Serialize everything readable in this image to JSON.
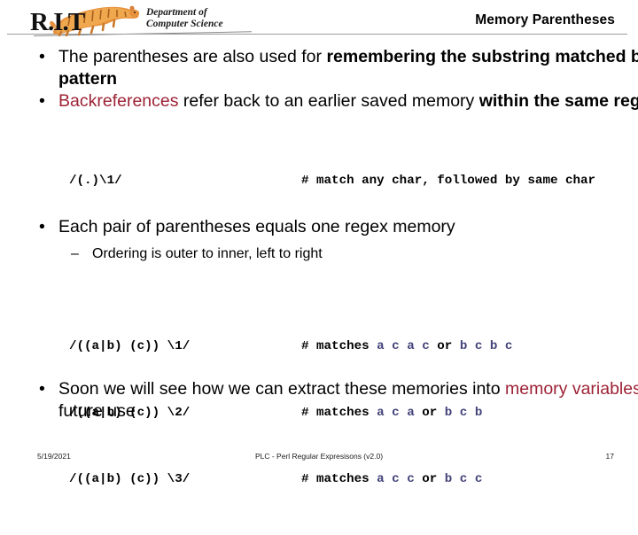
{
  "header": {
    "logo": {
      "rit_text": "R.I.T",
      "dept_line1": "Department of",
      "dept_line2": "Computer Science",
      "tiger_icon": "tiger-mascot-icon"
    },
    "title": "Memory Parentheses"
  },
  "slide": {
    "bullet1": {
      "marker": "•",
      "plain": "The parentheses are also used for ",
      "bold": "remembering the substring matched by the pattern"
    },
    "bullet2": {
      "marker": "•",
      "red": "Backreferences",
      "plain": " refer back to an earlier saved memory ",
      "bold": "within the same regex"
    },
    "code_block_1": {
      "pattern": "/(.)\\1/",
      "comment": "# match any char, followed by same char"
    },
    "bullet3": {
      "marker": "•",
      "text": "Each pair of parentheses equals one regex memory"
    },
    "subbullet1": {
      "marker": "–",
      "text": "Ordering is outer to inner, left to right"
    },
    "code_block_2": {
      "rows": [
        {
          "pattern": "/((a|b) (c)) \\1/",
          "comment_prefix": "# matches ",
          "match_a": "a c a c",
          "separator": " or ",
          "match_b": "b c b c"
        },
        {
          "pattern": "/((a|b) (c)) \\2/",
          "comment_prefix": "# matches ",
          "match_a": "a c a",
          "separator": " or ",
          "match_b": "b c b"
        },
        {
          "pattern": "/((a|b) (c)) \\3/",
          "comment_prefix": "# matches ",
          "match_a": "a c c",
          "separator": " or ",
          "match_b": "b c c"
        }
      ]
    },
    "bullet4": {
      "marker": "•",
      "plain1": "Soon we will see how we can extract these memories into ",
      "red": "memory variables",
      "plain2": " for future use"
    }
  },
  "footer": {
    "date": "5/19/2021",
    "center": "PLC - Perl Regular Expresisons  (v2.0)",
    "page": "17"
  },
  "colors": {
    "accent_red": "#9d2235",
    "memory_blue": "#43437a",
    "rule_gray": "#9b9b9b"
  }
}
